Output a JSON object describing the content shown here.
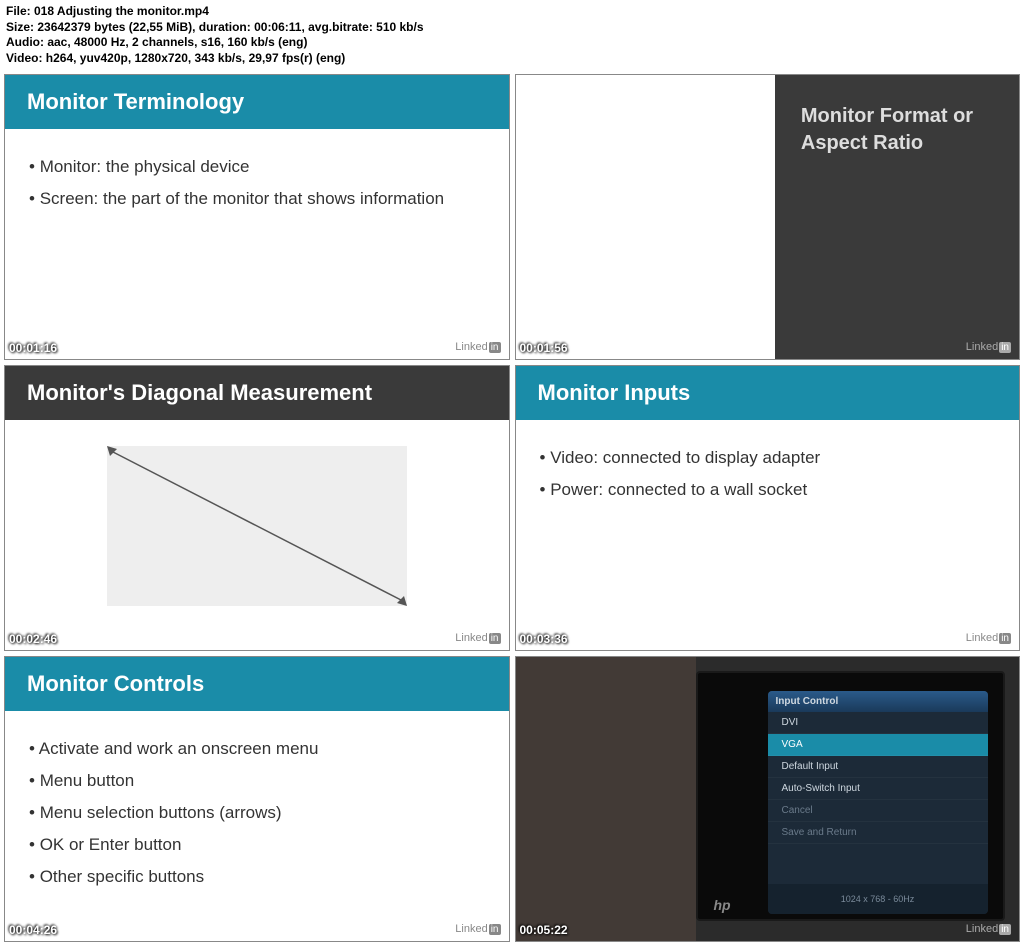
{
  "meta": {
    "file": "File: 018 Adjusting the monitor.mp4",
    "size": "Size: 23642379 bytes (22,55 MiB), duration: 00:06:11, avg.bitrate: 510 kb/s",
    "audio": "Audio: aac, 48000 Hz, 2 channels, s16, 160 kb/s (eng)",
    "video": "Video: h264, yuv420p, 1280x720, 343 kb/s, 29,97 fps(r) (eng)"
  },
  "brand": {
    "text": "Linked",
    "box": "in"
  },
  "cells": {
    "c1": {
      "ts": "00:01:16",
      "title": "Monitor Terminology",
      "bullets": [
        "Monitor: the physical device",
        "Screen: the part of the monitor that shows information"
      ]
    },
    "c2": {
      "ts": "00:01:56",
      "title": "Monitor Format or Aspect Ratio"
    },
    "c3": {
      "ts": "00:02:46",
      "title": "Monitor's Diagonal Measurement"
    },
    "c4": {
      "ts": "00:03:36",
      "title": "Monitor Inputs",
      "bullets": [
        "Video: connected to display adapter",
        "Power: connected to a wall socket"
      ]
    },
    "c5": {
      "ts": "00:04:26",
      "title": "Monitor Controls",
      "bullets": [
        "Activate and work an onscreen menu",
        "Menu button",
        "Menu selection buttons (arrows)",
        "OK or Enter button",
        "Other specific buttons"
      ]
    },
    "c6": {
      "ts": "00:05:22",
      "osd": {
        "head": "Input Control",
        "items": [
          "DVI",
          "VGA",
          "Default Input",
          "Auto-Switch Input",
          "Cancel",
          "Save and Return"
        ],
        "selected": 1,
        "foot": "1024 x 768 - 60Hz"
      },
      "hp": "hp"
    }
  }
}
